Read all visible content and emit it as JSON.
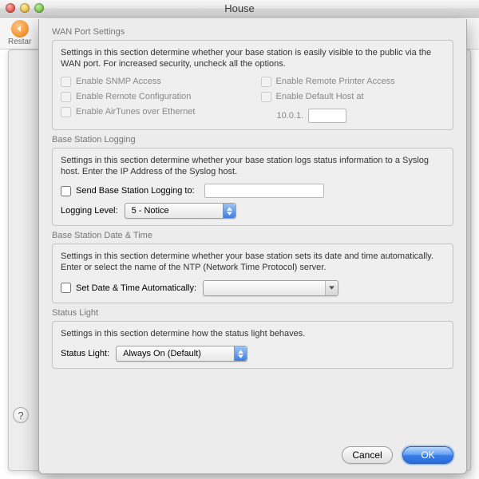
{
  "window": {
    "title": "House"
  },
  "toolbar": {
    "back_label": "Restar"
  },
  "wan": {
    "title": "WAN Port Settings",
    "desc": "Settings in this section determine whether your base station is easily visible to the public via the WAN port. For increased security, uncheck all the options.",
    "snmp": "Enable SNMP Access",
    "remote_cfg": "Enable Remote Configuration",
    "airtunes": "Enable AirTunes over Ethernet",
    "printer": "Enable Remote Printer Access",
    "defhost": "Enable Default Host at",
    "defhost_ip_prefix": "10.0.1.",
    "defhost_ip_value": ""
  },
  "logging": {
    "title": "Base Station Logging",
    "desc": "Settings in this section determine whether your base station logs status information to a Syslog host. Enter the IP Address of the Syslog host.",
    "send_label": "Send Base Station Logging to:",
    "send_value": "",
    "level_label": "Logging Level:",
    "level_value": "5 - Notice"
  },
  "datetime": {
    "title": "Base Station Date & Time",
    "desc": "Settings in this section determine whether your base station sets its date and time automatically. Enter or select the name of the NTP (Network Time Protocol) server.",
    "auto_label": "Set Date & Time Automatically:",
    "server_value": ""
  },
  "status": {
    "title": "Status Light",
    "desc": "Settings in this section determine how the status light behaves.",
    "label": "Status Light:",
    "value": "Always On (Default)"
  },
  "buttons": {
    "cancel": "Cancel",
    "ok": "OK"
  }
}
